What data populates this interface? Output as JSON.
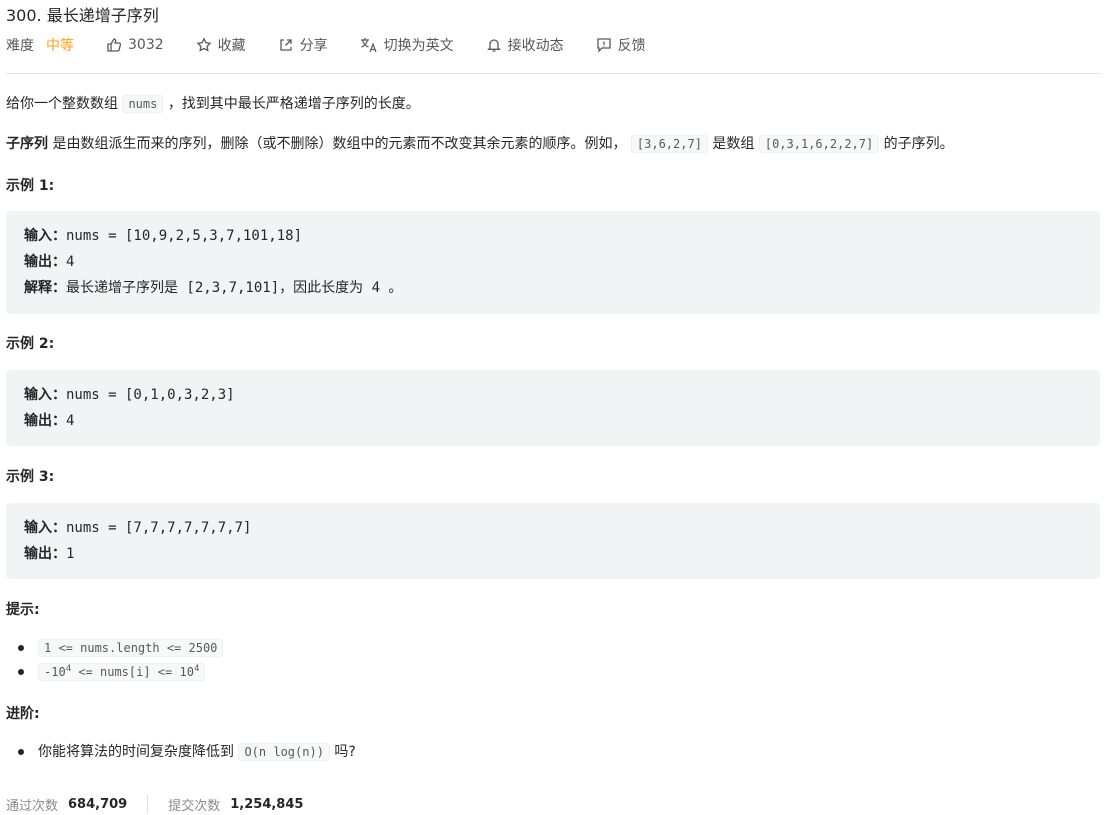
{
  "problem": {
    "title": "300. 最长递增子序列",
    "difficulty_label": "难度",
    "difficulty": "中等",
    "likes": "3032",
    "favorite": "收藏",
    "share": "分享",
    "switch_lang": "切换为英文",
    "follow": "接收动态",
    "feedback": "反馈"
  },
  "description": {
    "p1_a": "给你一个整数数组",
    "p1_code": "nums",
    "p1_b": "，找到其中最长严格递增子序列的长度。",
    "p2_strong": "子序列",
    "p2_a": "是由数组派生而来的序列，删除（或不删除）数组中的元素而不改变其余元素的顺序。例如，",
    "p2_code1": "[3,6,2,7]",
    "p2_b": "是数组",
    "p2_code2": "[0,3,1,6,2,2,7]",
    "p2_c": "的子序列。"
  },
  "examples": [
    {
      "heading": "示例 1:",
      "input_label": "输入：",
      "input": "nums = [10,9,2,5,3,7,101,18]",
      "output_label": "输出：",
      "output": "4",
      "explain_label": "解释：",
      "explain": "最长递增子序列是 [2,3,7,101]，因此长度为 4 。"
    },
    {
      "heading": "示例 2:",
      "input_label": "输入：",
      "input": "nums = [0,1,0,3,2,3]",
      "output_label": "输出：",
      "output": "4"
    },
    {
      "heading": "示例 3:",
      "input_label": "输入：",
      "input": "nums = [7,7,7,7,7,7,7]",
      "output_label": "输出：",
      "output": "1"
    }
  ],
  "hints": {
    "heading": "提示:",
    "c1": "1 <= nums.length <= 2500",
    "c2_a": "-10",
    "c2_sup1": "4",
    "c2_b": " <= nums[i] <= 10",
    "c2_sup2": "4"
  },
  "advanced": {
    "heading": "进阶:",
    "text_a": "你能将算法的时间复杂度降低到",
    "code": "O(n log(n))",
    "text_b": "吗?"
  },
  "stats": {
    "accepted_label": "通过次数",
    "accepted": "684,709",
    "submitted_label": "提交次数",
    "submitted": "1,254,845"
  },
  "colors": {
    "difficulty": "#ffa116",
    "code_bg": "#f2f3f5"
  }
}
